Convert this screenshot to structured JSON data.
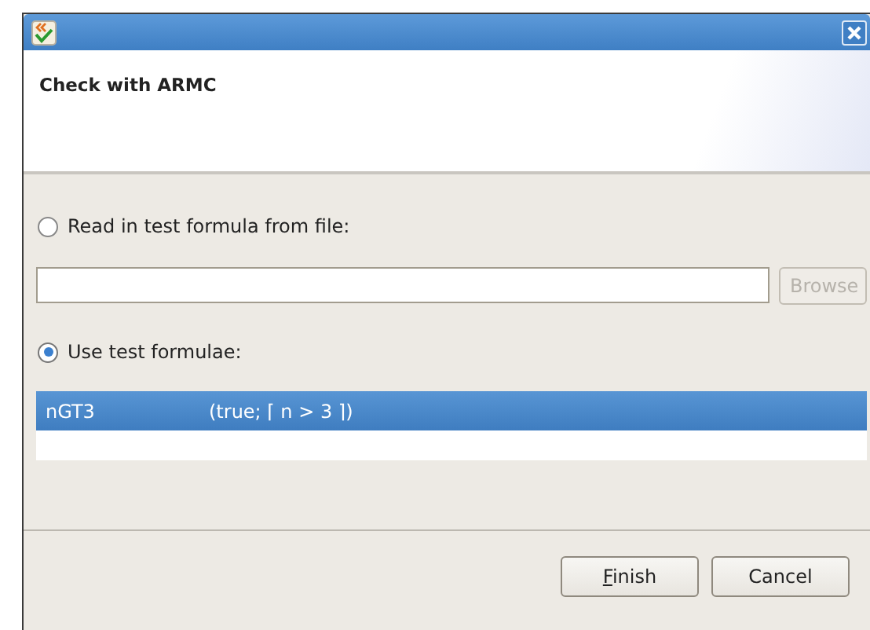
{
  "window": {
    "title": "Check with ARMC"
  },
  "file_option": {
    "label": "Read in test formula from file:",
    "selected": false
  },
  "browse_button": {
    "label": "Browse",
    "disabled": true
  },
  "formulae_option": {
    "label": "Use test formulae:",
    "selected": true
  },
  "formulae": [
    {
      "name": "nGT3",
      "formula": "(true; ⌈ n > 3 ⌉)",
      "selected": true
    }
  ],
  "buttons": [
    {
      "label": "Finish",
      "mnemonic": true
    },
    {
      "label": "Cancel",
      "mnemonic": false
    }
  ]
}
